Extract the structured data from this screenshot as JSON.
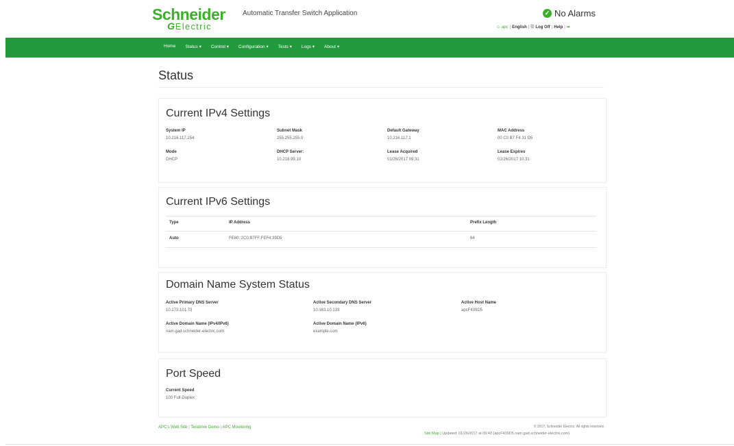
{
  "header": {
    "logo_top": "Schneider",
    "logo_mark": "G",
    "logo_bottom": "Electric",
    "app_title": "Automatic Transfer Switch Application",
    "alarm_text": "No Alarms",
    "utils": {
      "user": "apc",
      "language": "English",
      "logoff": "Log Off",
      "help": "Help"
    }
  },
  "nav": [
    "Home",
    "Status ▾",
    "Control ▾",
    "Configuration ▾",
    "Tests ▾",
    "Logs ▾",
    "About ▾"
  ],
  "page_title": "Status",
  "ipv4": {
    "title": "Current IPv4 Settings",
    "fields": [
      {
        "label": "System IP",
        "value": "10.216.117.154"
      },
      {
        "label": "Subnet Mask",
        "value": "255.255.255.0"
      },
      {
        "label": "Default Gateway",
        "value": "10.216.117.1"
      },
      {
        "label": "MAC Address",
        "value": "00 C0 B7 F4 31 D5"
      },
      {
        "label": "Mode",
        "value": "DHCP"
      },
      {
        "label": "DHCP Server:",
        "value": "10.218.99.10"
      },
      {
        "label": "Lease Acquired",
        "value": "01/26/2017 09:31"
      },
      {
        "label": "Lease Expires",
        "value": "01/26/2017 10:31"
      }
    ]
  },
  "ipv6": {
    "title": "Current IPv6 Settings",
    "columns": [
      "Type",
      "IP Address",
      "Prefix Length"
    ],
    "rows": [
      {
        "type": "Auto",
        "address": "FE80::2C0:B7FF:FEF4:39D5",
        "prefix": "64"
      }
    ]
  },
  "dns": {
    "title": "Domain Name System Status",
    "fields": [
      {
        "label": "Active Primary DNS Server",
        "value": "10.173.101.73"
      },
      {
        "label": "Active Secondary DNS Server",
        "value": "10.163.10.133"
      },
      {
        "label": "Active Host Name",
        "value": "apcF439D5"
      },
      {
        "label": "Active Domain Name (IPv4/IPv6)",
        "value": "nam.gad.schneider-electric.com"
      },
      {
        "label": "Active Domain Name (IPv6)",
        "value": "example.com"
      }
    ]
  },
  "port": {
    "title": "Port Speed",
    "label": "Current Speed",
    "value": "100 Full-Duplex"
  },
  "footer": {
    "links": [
      "APC's Web Site",
      "Testdrive Demo",
      "APC Monitoring"
    ],
    "copyright": "© 2017, Schneider Electric. All rights reserved.",
    "sitemap": "Site Map",
    "updated": "| Updated: 01/26/2017 at 09:43 (apcF439D5.nam.gad.schneider-electric.com)"
  },
  "colors": {
    "brand_green": "#3dae2b",
    "nav_green": "#229a3d"
  }
}
